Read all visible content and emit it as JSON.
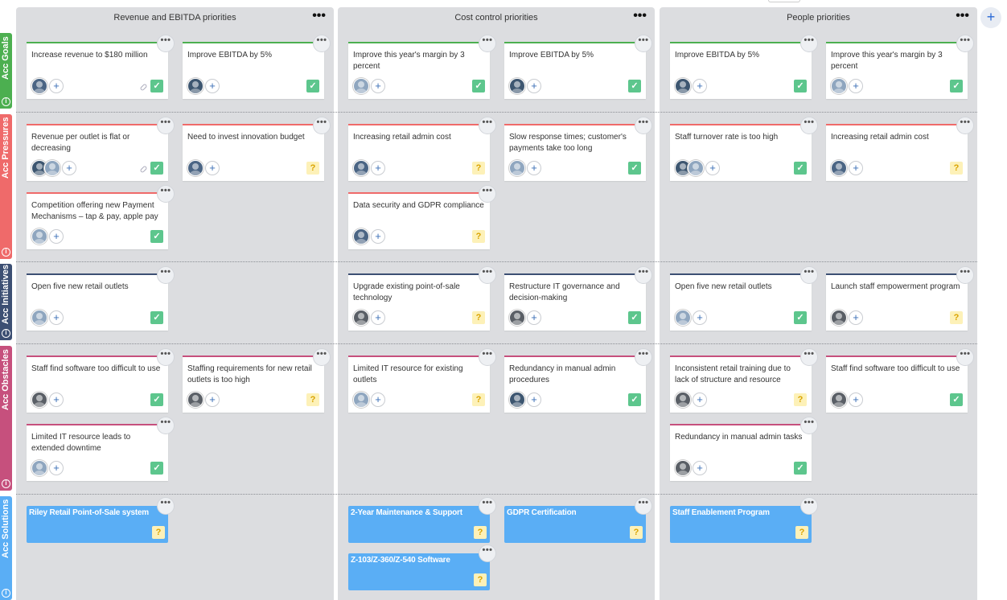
{
  "columns": [
    {
      "title": "Revenue and EBITDA priorities",
      "menu": "•••"
    },
    {
      "title": "Cost control priorities",
      "menu": "•••"
    },
    {
      "title": "People priorities",
      "menu": "•••"
    }
  ],
  "lanes": [
    {
      "label": "Acc Goals",
      "color": "#4caf50"
    },
    {
      "label": "Acc Pressures",
      "color": "#ef6a6a"
    },
    {
      "label": "Acc Initiatives",
      "color": "#3c4f73"
    },
    {
      "label": "Acc Obstacles",
      "color": "#c6507d"
    },
    {
      "label": "Acc Solutions",
      "color": "#5aaef5"
    }
  ],
  "add_column_label": "+",
  "info_glyph": "i",
  "more_glyph": "•••",
  "plus_glyph": "+",
  "ok_glyph": "✓",
  "q_glyph": "?",
  "cards": {
    "g1": "Increase revenue to $180 million",
    "g2": "Improve EBITDA by 5%",
    "g3": "Improve this year's margin by 3 percent",
    "g4": "Improve EBITDA by 5%",
    "g5": "Improve EBITDA by 5%",
    "g6": "Improve this year's margin by 3 percent",
    "p1": "Revenue per outlet is flat or decreasing",
    "p2": "Need to invest innovation budget",
    "p3": "Competition offering new Payment Mechanisms – tap & pay, apple pay",
    "p4": "Increasing retail admin cost",
    "p5": "Slow response times; customer's payments take too long",
    "p6": "Data security and GDPR compliance",
    "p7": "Staff turnover rate is too high",
    "p8": "Increasing retail admin cost",
    "i1": "Open five new retail outlets",
    "i2": "Upgrade existing point-of-sale technology",
    "i3": "Restructure IT governance and decision-making",
    "i4": "Open five new retail outlets",
    "i5": "Launch staff empowerment program",
    "o1": "Staff find software too difficult to use",
    "o2": "Staffing requirements for new retail outlets is too high",
    "o3": "Limited IT resource leads to extended downtime",
    "o4": "Limited IT resource for existing outlets",
    "o5": "Redundancy in manual admin procedures",
    "o6": "Inconsistent retail training due to lack of structure and resource",
    "o7": "Staff find software too difficult to use",
    "o8": "Redundancy in manual admin tasks",
    "s1": "Riley Retail Point-of-Sale system",
    "s2": "2-Year Maintenance & Support",
    "s3": "GDPR Certification",
    "s4": "Z-103/Z-360/Z-540 Software",
    "s5": "Staff Enablement Program"
  }
}
